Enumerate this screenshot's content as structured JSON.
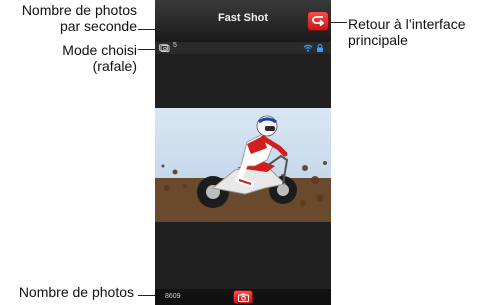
{
  "app": {
    "title": "Fast Shot"
  },
  "status": {
    "photos_per_second": "5",
    "mode_icon": "burst-camera-icon",
    "wifi_icon": "wifi-icon",
    "lock_icon": "lock-icon"
  },
  "footer": {
    "photo_count": "8609",
    "shutter_icon": "camera-icon"
  },
  "annotations": {
    "rate_label": "Nombre de photos\npar seconde",
    "mode_label": "Mode choisi\n(rafale)",
    "back_label": "Retour à l’interface\nprincipale",
    "count_label": "Nombre de photos"
  },
  "colors": {
    "accent_red": "#e02424",
    "screen_bg": "#202020",
    "bar_bg": "#111111"
  }
}
